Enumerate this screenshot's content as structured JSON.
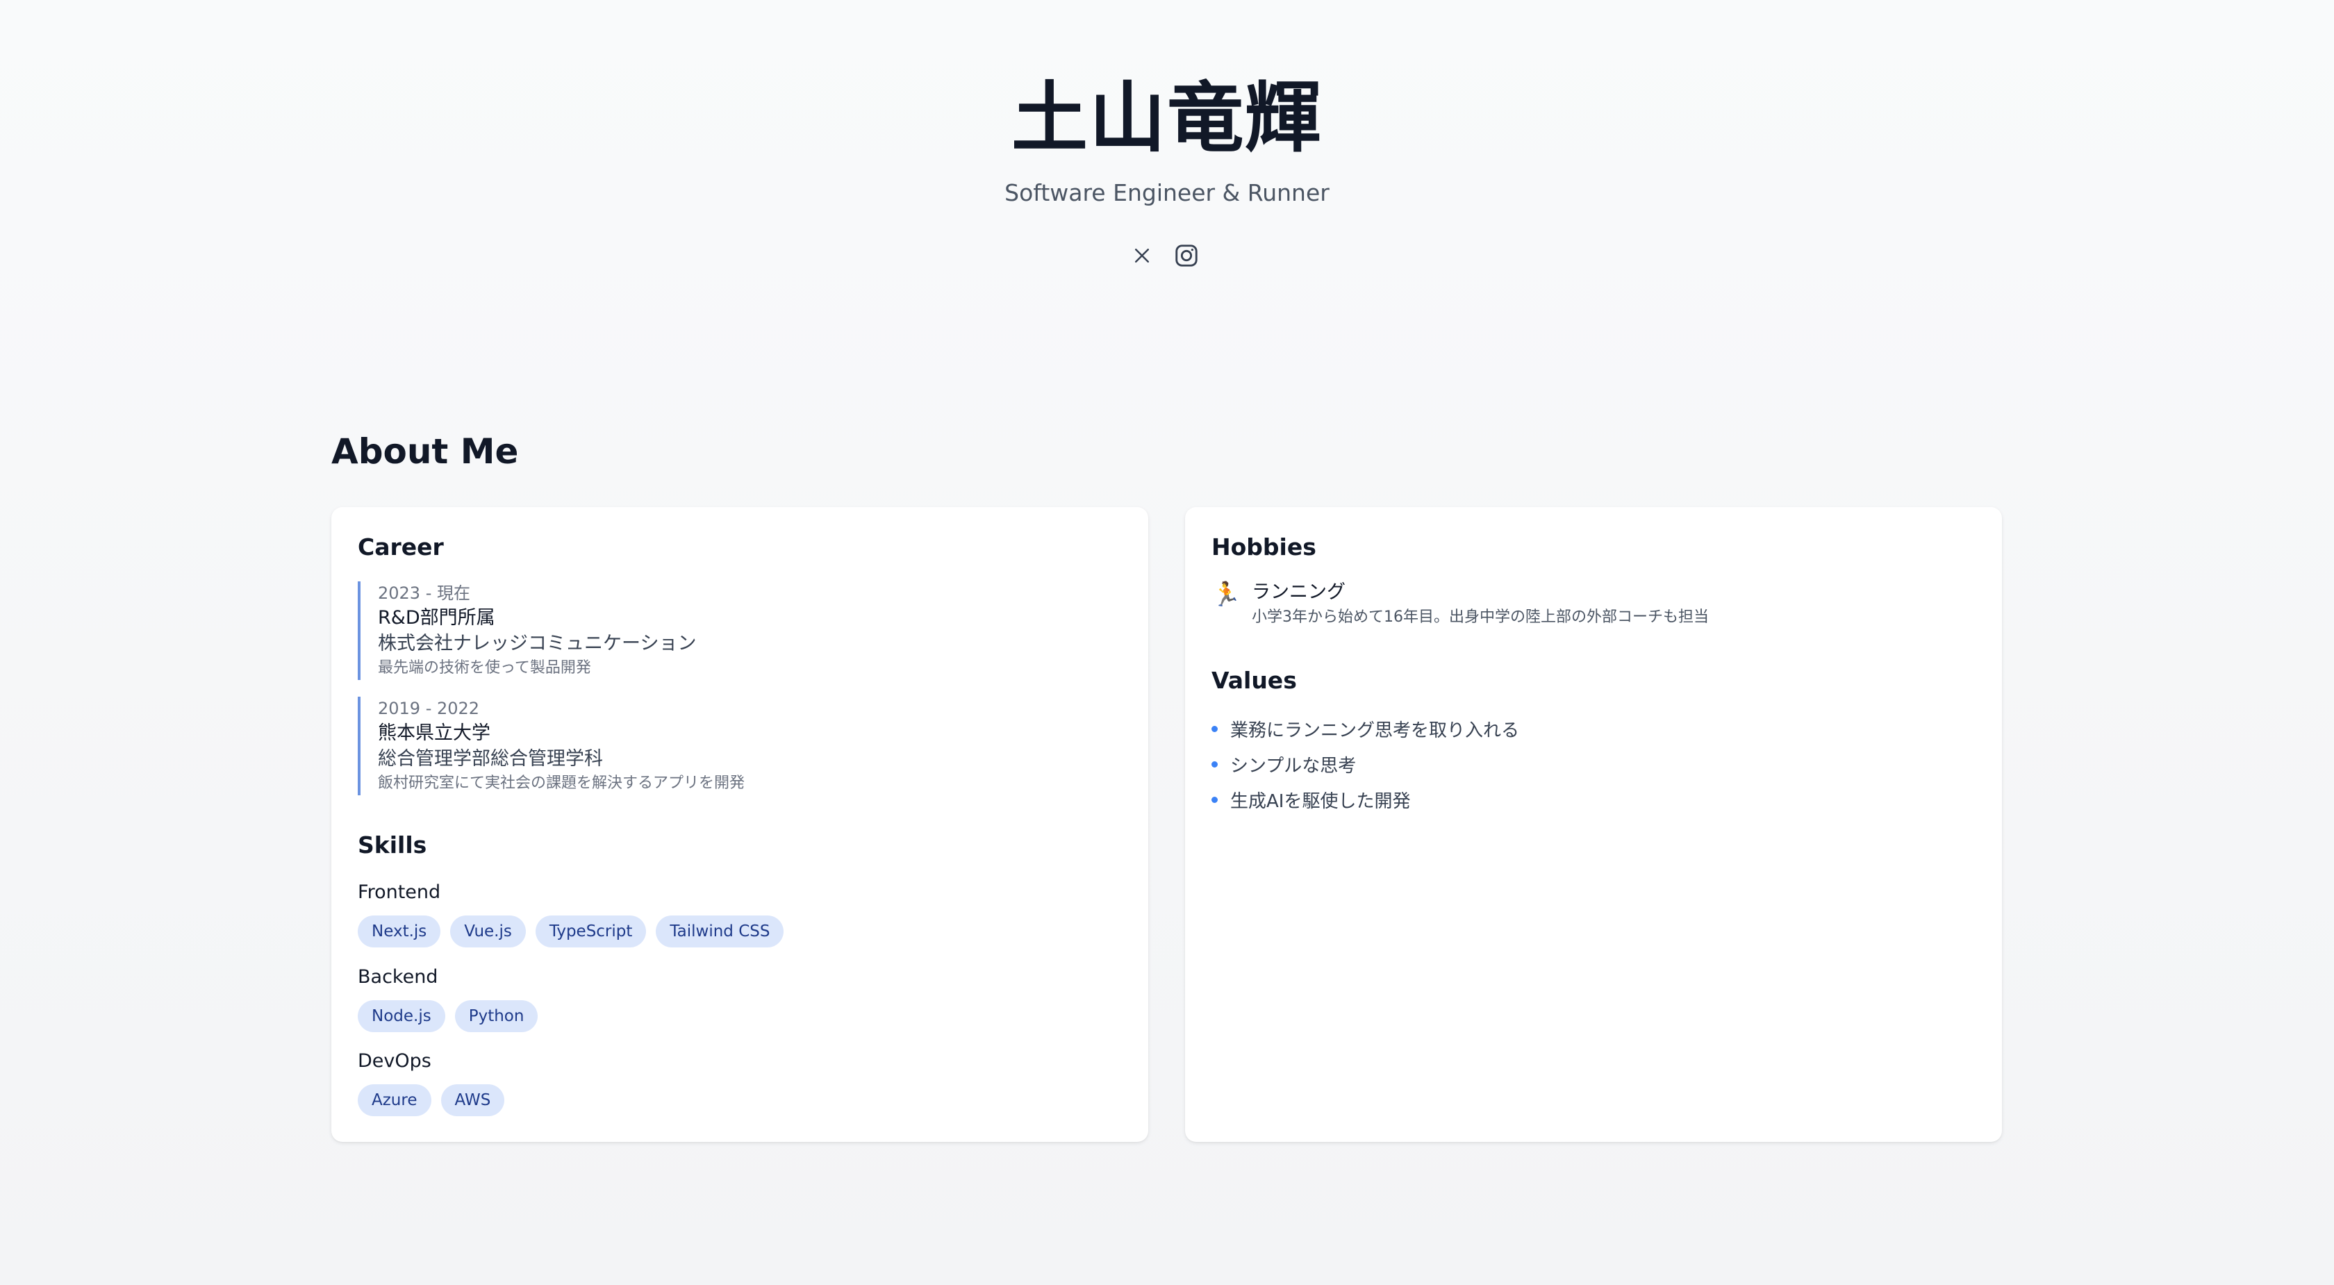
{
  "profile": {
    "name": "土山竜輝",
    "subtitle": "Software Engineer & Runner"
  },
  "social": [
    {
      "icon": "x-icon"
    },
    {
      "icon": "instagram-icon"
    }
  ],
  "about": {
    "title": "About Me",
    "career": {
      "heading": "Career",
      "items": [
        {
          "period": "2023 - 現在",
          "title": "R&D部門所属",
          "org": "株式会社ナレッジコミュニケーション",
          "desc": "最先端の技術を使って製品開発"
        },
        {
          "period": "2019 - 2022",
          "title": "熊本県立大学",
          "org": "総合管理学部総合管理学科",
          "desc": "飯村研究室にて実社会の課題を解決するアプリを開発"
        }
      ]
    },
    "skills": {
      "heading": "Skills",
      "categories": [
        {
          "name": "Frontend",
          "tags": [
            "Next.js",
            "Vue.js",
            "TypeScript",
            "Tailwind CSS"
          ]
        },
        {
          "name": "Backend",
          "tags": [
            "Node.js",
            "Python"
          ]
        },
        {
          "name": "DevOps",
          "tags": [
            "Azure",
            "AWS"
          ]
        }
      ]
    },
    "hobbies": {
      "heading": "Hobbies",
      "items": [
        {
          "icon": "runner-icon",
          "icon_glyph": "🏃",
          "name": "ランニング",
          "desc": "小学3年から始めて16年目。出身中学の陸上部の外部コーチも担当"
        }
      ]
    },
    "values": {
      "heading": "Values",
      "items": [
        "業務にランニング思考を取り入れる",
        "シンプルな思考",
        "生成AIを駆使した開発"
      ]
    }
  },
  "colors": {
    "accent": "#3b82f6",
    "tag_bg": "#dbe6fb",
    "tag_text": "#1e3a8a",
    "timeline_border": "#6b93e0"
  }
}
